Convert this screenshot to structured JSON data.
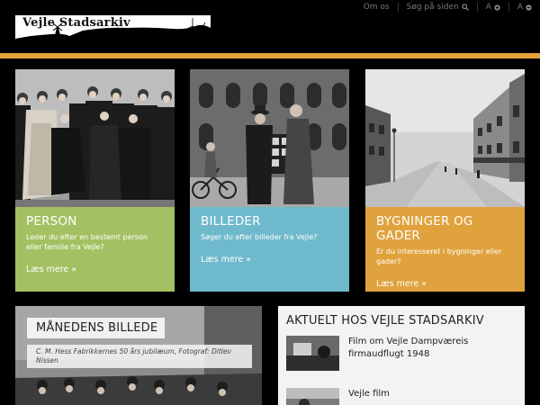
{
  "topbar": {
    "about_label": "Om os",
    "search_label": "Søg på siden",
    "font_increase_label": "A",
    "font_decrease_label": "A"
  },
  "logo": {
    "text": "Vejle Stadsarkiv"
  },
  "colors": {
    "stripe": "#e3a13a",
    "person": "#a3c163",
    "billeder": "#6fb9cc",
    "bygninger": "#e0a23d"
  },
  "cards": [
    {
      "title": "PERSON",
      "text": "Leder du efter en bestemt person eller familie fra Vejle?",
      "more": "Læs mere »"
    },
    {
      "title": "BILLEDER",
      "text": "Søger du efter billeder fra Vejle?",
      "more": "Læs mere »"
    },
    {
      "title": "BYGNINGER OG GADER",
      "text": "Er du interesseret i bygninger eller gader?",
      "more": "Læs mere »"
    }
  ],
  "month": {
    "label": "MÅNEDENS BILLEDE",
    "caption": "C. M. Hess Fabrikkernes 50 års jubilæum, Fotograf: Ditlev Nissen"
  },
  "news": {
    "heading": "AKTUELT HOS VEJLE STADSARKIV",
    "items": [
      {
        "title": "Film om Vejle Dampværeis firmaudflugt 1948"
      },
      {
        "title": "Vejle film"
      }
    ]
  }
}
